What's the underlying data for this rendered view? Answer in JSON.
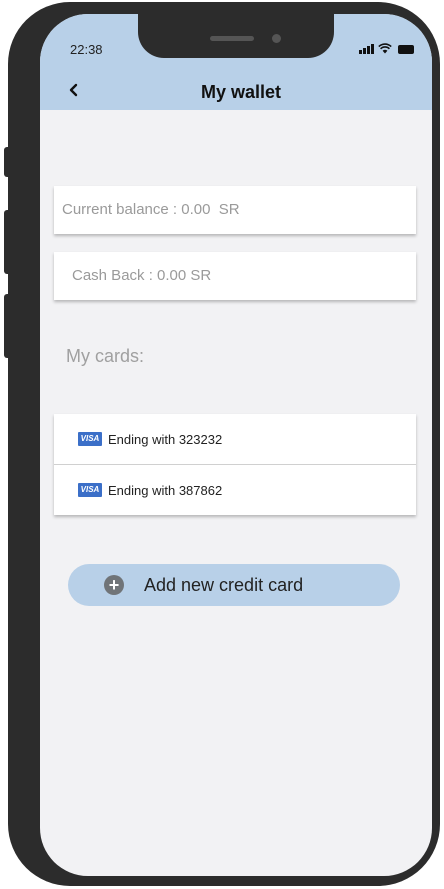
{
  "status_bar": {
    "time": "22:38"
  },
  "header": {
    "back_icon": "chevron-left-icon",
    "title": "My wallet"
  },
  "balance": {
    "current_text": "Current balance : 0.00  SR",
    "cashback_text": "Cash Back : 0.00 SR"
  },
  "cards_section": {
    "label": "My cards:",
    "cards": [
      {
        "brand": "VISA",
        "text": "Ending with 323232"
      },
      {
        "brand": "VISA",
        "text": "Ending with 387862"
      }
    ]
  },
  "add_card": {
    "label": "Add new credit card",
    "icon": "plus-circle-icon"
  },
  "colors": {
    "header_bg": "#b8d0e8",
    "button_bg": "#b8d0e8",
    "screen_bg": "#f2f2f4",
    "visa_blue": "#3b6fc8"
  }
}
